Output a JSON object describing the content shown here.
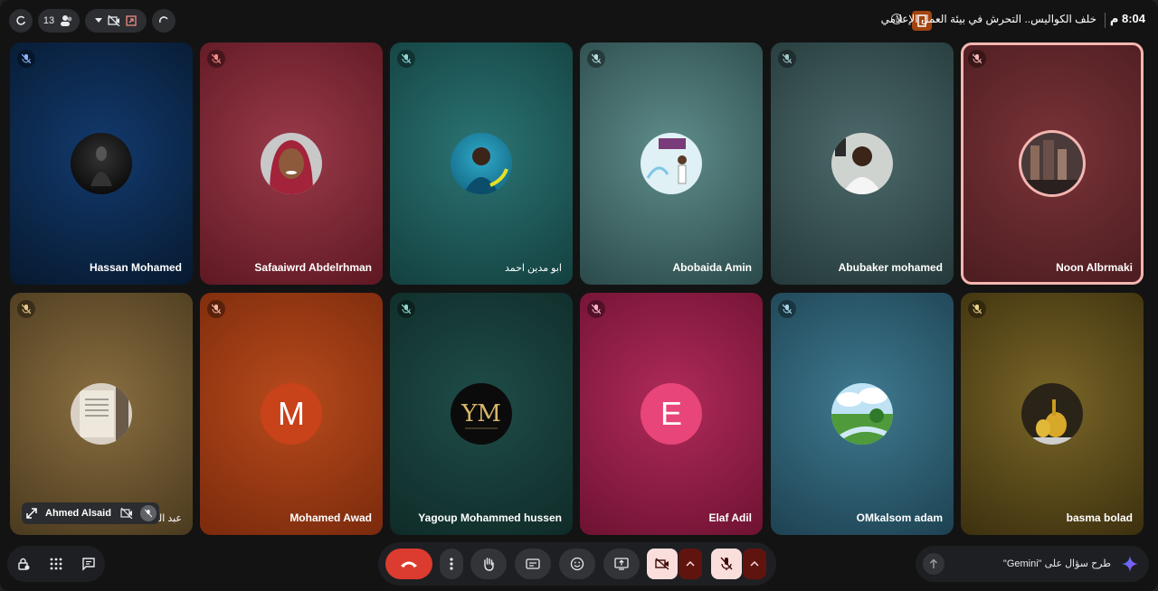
{
  "topbar": {
    "clock": "8:04 م",
    "meeting_title": "خلف الكواليس.. التحرش في بيئة العمل الإعلامي",
    "participant_count": "13"
  },
  "tiles": [
    {
      "name": "Hassan Mohamed",
      "bg": "#0d2a52",
      "avatar": "dark-photo"
    },
    {
      "name": "Safaaiwrd Abdelrhman",
      "bg": "#7a2533",
      "avatar": "photo"
    },
    {
      "name": "ابو مدين احمد",
      "bg": "#1f5a5c",
      "avatar": "photo"
    },
    {
      "name": "Abobaida Amin",
      "bg": "#3d6a6a",
      "avatar": "photo"
    },
    {
      "name": "Abubaker mohamed",
      "bg": "#3a5253",
      "avatar": "photo"
    },
    {
      "name": "Noon Albrmaki",
      "bg": "#6a2a2e",
      "avatar": "photo"
    },
    {
      "name": "عبد القا",
      "bg": "#6e5530",
      "avatar": "photo"
    },
    {
      "name": "Mohamed Awad",
      "bg": "#a53b12",
      "avatar": "letter",
      "letter": "M",
      "letter_bg": "#c8421a"
    },
    {
      "name": "Yagoup Mohammed hussen",
      "bg": "#163a36",
      "avatar": "logo"
    },
    {
      "name": "Elaf Adil",
      "bg": "#8f1c47",
      "avatar": "letter",
      "letter": "E",
      "letter_bg": "#e8457a"
    },
    {
      "name": "OMkalsom adam",
      "bg": "#2f5a6e",
      "avatar": "photo"
    },
    {
      "name": "basma bolad",
      "bg": "#5a4a1c",
      "avatar": "photo"
    }
  ],
  "pinned_overlay": {
    "label": "Ahmed Alsaid"
  },
  "gemini": {
    "placeholder": "طرح سؤال على \"Gemini\""
  },
  "colors": {
    "end_call": "#dc3b2f",
    "muted_bg": "#f9dedc",
    "muted_arrow": "#601410"
  }
}
